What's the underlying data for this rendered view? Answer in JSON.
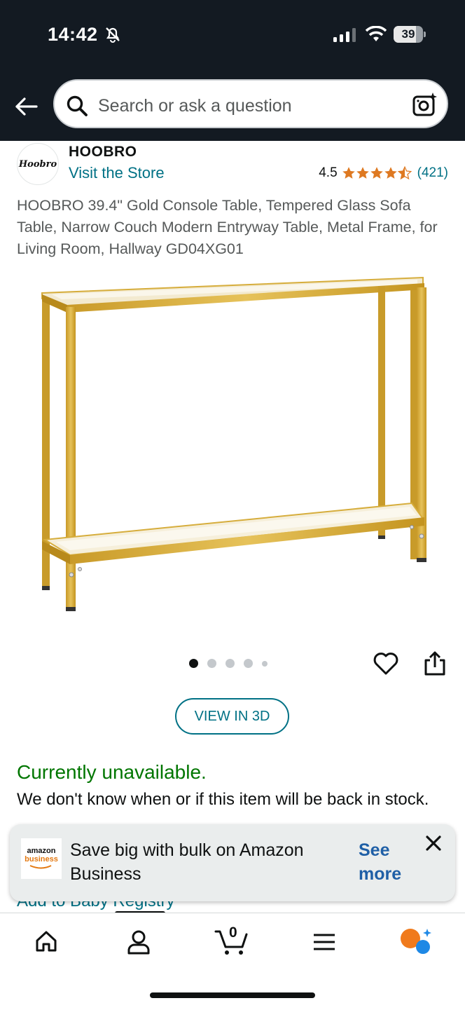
{
  "status_bar": {
    "time": "14:42",
    "battery_level": "39"
  },
  "search": {
    "placeholder": "Search or ask a question"
  },
  "brand": {
    "logo_text": "Hoobro",
    "name": "HOOBRO",
    "visit_store_label": "Visit the Store"
  },
  "rating": {
    "value": "4.5",
    "stars": 4.5,
    "count": "(421)"
  },
  "product": {
    "title": "HOOBRO 39.4\" Gold Console Table, Tempered Glass Sofa Table, Narrow Couch Modern Entryway Table, Metal Frame, for Living Room, Hallway GD04XG01",
    "image_count": 5,
    "active_image": 1
  },
  "actions": {
    "view_3d_label": "VIEW IN 3D"
  },
  "availability": {
    "status": "Currently unavailable.",
    "note": "We don't know when or if this item will be back in stock."
  },
  "registry": {
    "label": "Add to Baby Registry"
  },
  "promo": {
    "logo_line1": "amazon",
    "logo_line2": "business",
    "text": "Save big with bulk on Amazon Business",
    "link_label": "See more"
  },
  "bottom_nav": {
    "cart_count": "0",
    "items": [
      "home-icon",
      "account-icon",
      "cart-icon",
      "menu-icon",
      "rufus-icon"
    ]
  },
  "colors": {
    "header_bg": "#131a22",
    "link": "#007185",
    "star": "#de7921",
    "available_green": "#007600",
    "gold_frame": "#d4a72c"
  }
}
